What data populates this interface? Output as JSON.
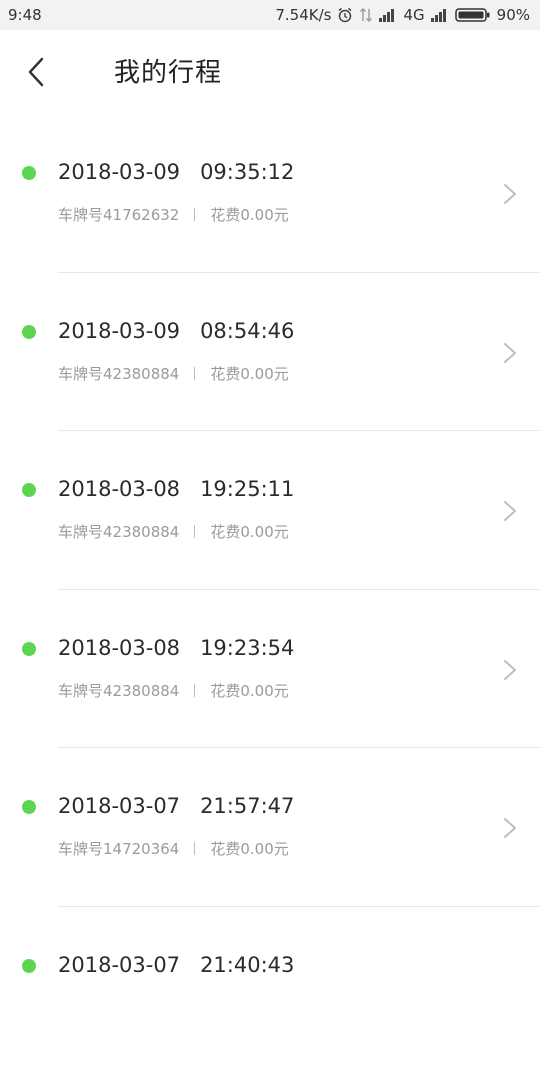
{
  "status_bar": {
    "time": "9:48",
    "net_speed": "7.54K/s",
    "network": "4G",
    "battery": "90%",
    "icons": [
      "alarm-icon",
      "data-arrows-icon",
      "signal-icon",
      "signal-icon",
      "battery-icon"
    ]
  },
  "header": {
    "title": "我的行程",
    "back_icon": "chevron-left-icon"
  },
  "trips": [
    {
      "datetime": "2018-03-09   09:35:12",
      "plate": "车牌号41762632",
      "cost": "花费0.00元"
    },
    {
      "datetime": "2018-03-09   08:54:46",
      "plate": "车牌号42380884",
      "cost": "花费0.00元"
    },
    {
      "datetime": "2018-03-08   19:25:11",
      "plate": "车牌号42380884",
      "cost": "花费0.00元"
    },
    {
      "datetime": "2018-03-08   19:23:54",
      "plate": "车牌号42380884",
      "cost": "花费0.00元"
    },
    {
      "datetime": "2018-03-07   21:57:47",
      "plate": "车牌号14720364",
      "cost": "花费0.00元"
    },
    {
      "datetime": "2018-03-07   21:40:43",
      "plate": "",
      "cost": ""
    }
  ],
  "colors": {
    "status_dot": "#5cd652",
    "divider": "#e8e8e8",
    "secondary_text": "#9b9b9b"
  }
}
